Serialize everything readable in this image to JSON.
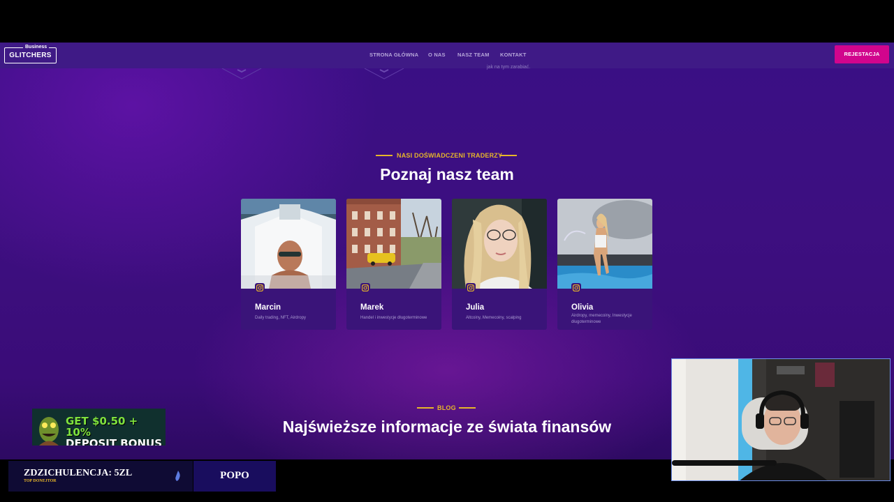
{
  "nav": {
    "logo_small": "Business",
    "logo_big": "GLITCHERS",
    "links": [
      "STRONA GŁÓWNA",
      "O NAS",
      "NASZ TEAM",
      "KONTAKT"
    ],
    "cta_label": "REJESTACJA"
  },
  "prev_section": {
    "fragment_text": "jak na tym zarabiać."
  },
  "team": {
    "eyebrow": "NASI DOŚWIADCZENI TRADERZY",
    "title": "Poznaj nasz team",
    "members": [
      {
        "name": "Marcin",
        "role": "Daily trading, NFT, Airdropy"
      },
      {
        "name": "Marek",
        "role": "Handel i inwestycje długoterminowe"
      },
      {
        "name": "Julia",
        "role": "Altcoiny, Memecoiny, scalping"
      },
      {
        "name": "Olivia",
        "role": "Airdropy, memecoiny, Inwestycje długoterminowe"
      }
    ]
  },
  "blog": {
    "eyebrow": "BLOG",
    "title": "Najświeższe informacje ze świata finansów"
  },
  "overlay": {
    "bonus_line1": "GET $0.50 + 10%",
    "bonus_line2": "DEPOSIT BONUS",
    "donor_main": "ZDZICHULENCJA: 5ZL",
    "donor_sub": "TOP DONEJTOR",
    "popo": "POPO"
  },
  "colors": {
    "accent_gold": "#e7b62a",
    "cta_pink": "#d1058d",
    "nav_bg": "#3f1a86",
    "page_purple": "#3a0f85"
  }
}
